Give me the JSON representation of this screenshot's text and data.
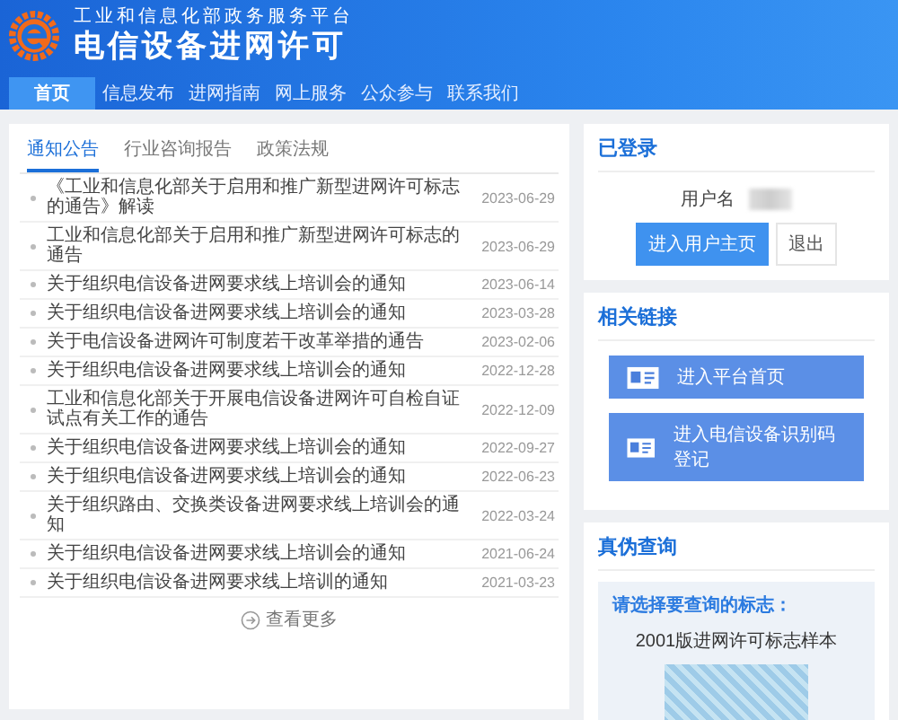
{
  "header": {
    "subtitle": "工业和信息化部政务服务平台",
    "title": "电信设备进网许可"
  },
  "nav": [
    {
      "label": "首页",
      "selected": true
    },
    {
      "label": "信息发布",
      "selected": false
    },
    {
      "label": "进网指南",
      "selected": false
    },
    {
      "label": "网上服务",
      "selected": false
    },
    {
      "label": "公众参与",
      "selected": false
    },
    {
      "label": "联系我们",
      "selected": false
    }
  ],
  "news": {
    "tabs": [
      {
        "label": "通知公告",
        "selected": true
      },
      {
        "label": "行业咨询报告",
        "selected": false
      },
      {
        "label": "政策法规",
        "selected": false
      }
    ],
    "items": [
      {
        "title": "《工业和信息化部关于启用和推广新型进网许可标志的通告》解读",
        "date": "2023-06-29"
      },
      {
        "title": "工业和信息化部关于启用和推广新型进网许可标志的通告",
        "date": "2023-06-29"
      },
      {
        "title": "关于组织电信设备进网要求线上培训会的通知",
        "date": "2023-06-14"
      },
      {
        "title": "关于组织电信设备进网要求线上培训会的通知",
        "date": "2023-03-28"
      },
      {
        "title": "关于电信设备进网许可制度若干改革举措的通告",
        "date": "2023-02-06"
      },
      {
        "title": "关于组织电信设备进网要求线上培训会的通知",
        "date": "2022-12-28"
      },
      {
        "title": "工业和信息化部关于开展电信设备进网许可自检自证试点有关工作的通告",
        "date": "2022-12-09"
      },
      {
        "title": "关于组织电信设备进网要求线上培训会的通知",
        "date": "2022-09-27"
      },
      {
        "title": "关于组织电信设备进网要求线上培训会的通知",
        "date": "2022-06-23"
      },
      {
        "title": "关于组织路由、交换类设备进网要求线上培训会的通知",
        "date": "2022-03-24"
      },
      {
        "title": "关于组织电信设备进网要求线上培训会的通知",
        "date": "2021-06-24"
      },
      {
        "title": "关于组织电信设备进网要求线上培训的通知",
        "date": "2021-03-23"
      }
    ],
    "more": "查看更多"
  },
  "login": {
    "title": "已登录",
    "username_label": "用户名",
    "buttons": [
      {
        "label": "进入用户主页",
        "kind": "primary"
      },
      {
        "label": "退出",
        "kind": "plain"
      }
    ]
  },
  "links": {
    "title": "相关链接",
    "items": [
      "进入平台首页",
      "进入电信设备识别码登记"
    ]
  },
  "verify": {
    "title": "真伪查询",
    "prompt": "请选择要查询的标志：",
    "sample_caption": "2001版进网许可标志样本"
  }
}
